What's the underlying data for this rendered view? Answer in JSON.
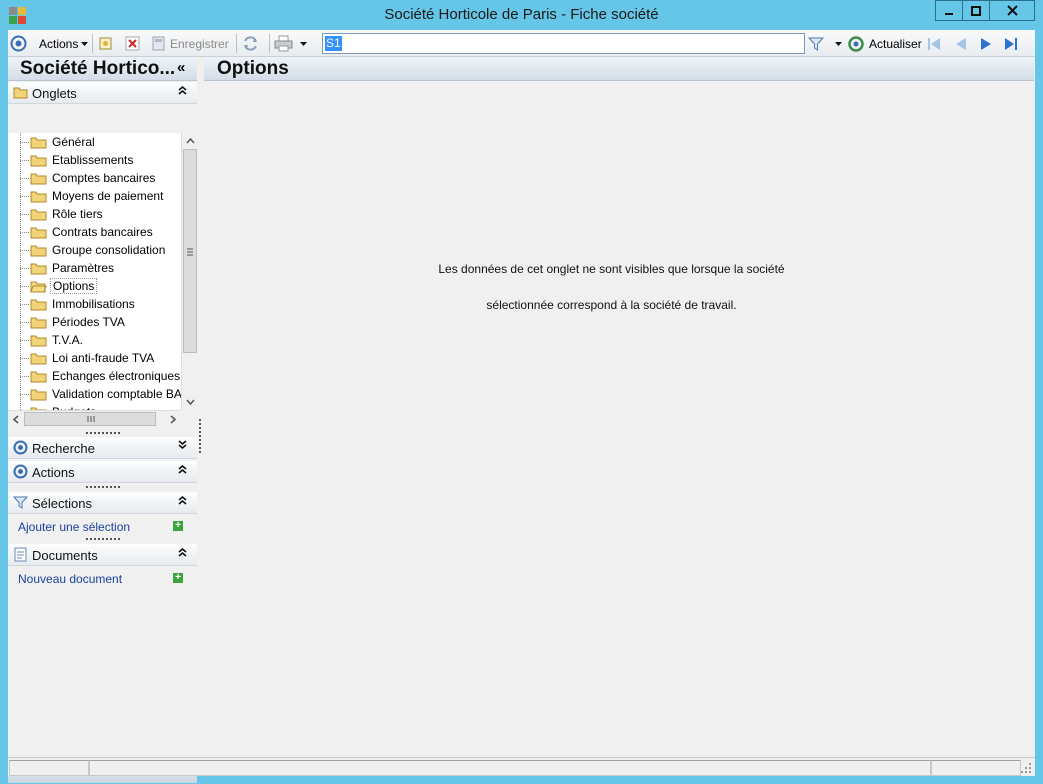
{
  "window": {
    "title": "Société Horticole de Paris -  Fiche société"
  },
  "toolbar": {
    "actions_label": "Actions",
    "save_label": "Enregistrer",
    "search_value": "S1",
    "refresh_label": "Actualiser"
  },
  "left_panel": {
    "title": "Société Hortico...",
    "onglets_label": "Onglets",
    "tree_items": [
      {
        "label": "Général"
      },
      {
        "label": "Etablissements"
      },
      {
        "label": "Comptes bancaires"
      },
      {
        "label": "Moyens de paiement"
      },
      {
        "label": "Rôle tiers"
      },
      {
        "label": "Contrats bancaires"
      },
      {
        "label": "Groupe consolidation"
      },
      {
        "label": "Paramètres"
      },
      {
        "label": "Options"
      },
      {
        "label": "Immobilisations"
      },
      {
        "label": "Périodes TVA"
      },
      {
        "label": "T.V.A."
      },
      {
        "label": "Loi anti-fraude TVA"
      },
      {
        "label": "Echanges électroniques"
      },
      {
        "label": "Validation comptable BA"
      },
      {
        "label": "Budgets"
      }
    ],
    "selected_item": "Options",
    "recherche_label": "Recherche",
    "actions_label": "Actions",
    "selections_label": "Sélections",
    "add_selection_label": "Ajouter une sélection",
    "documents_label": "Documents",
    "new_document_label": "Nouveau document"
  },
  "main": {
    "title": "Options",
    "message_line1": "Les données de cet onglet ne sont visibles que lorsque la société",
    "message_line2": "sélectionnée correspond à la société de travail."
  },
  "colors": {
    "frame": "#65c6e8",
    "link": "#1a3fa0",
    "selection": "#3390ff"
  }
}
